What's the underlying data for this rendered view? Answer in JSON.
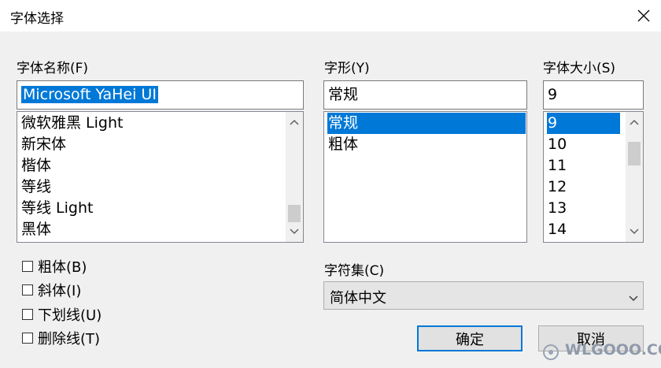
{
  "window": {
    "title": "字体选择"
  },
  "font_name": {
    "label": "字体名称(F)",
    "value": "Microsoft YaHei UI",
    "items": [
      "微软雅黑 Light",
      "新宋体",
      "楷体",
      "等线",
      "等线 Light",
      "黑体"
    ]
  },
  "font_style": {
    "label": "字形(Y)",
    "value": "常规",
    "items": [
      "常规",
      "粗体"
    ],
    "selected": "常规"
  },
  "font_size": {
    "label": "字体大小(S)",
    "value": "9",
    "items": [
      "9",
      "10",
      "11",
      "12",
      "13",
      "14"
    ],
    "selected": "9"
  },
  "effects": {
    "bold": "粗体(B)",
    "italic": "斜体(I)",
    "underline": "下划线(U)",
    "strikethrough": "删除线(T)"
  },
  "charset": {
    "label": "字符集(C)",
    "value": "简体中文"
  },
  "buttons": {
    "ok": "确定",
    "cancel": "取消"
  },
  "watermark": {
    "text": "WLGOOO.COM"
  },
  "colors": {
    "selection": "#0078d7",
    "dialog_bg": "#f0f0f0"
  }
}
